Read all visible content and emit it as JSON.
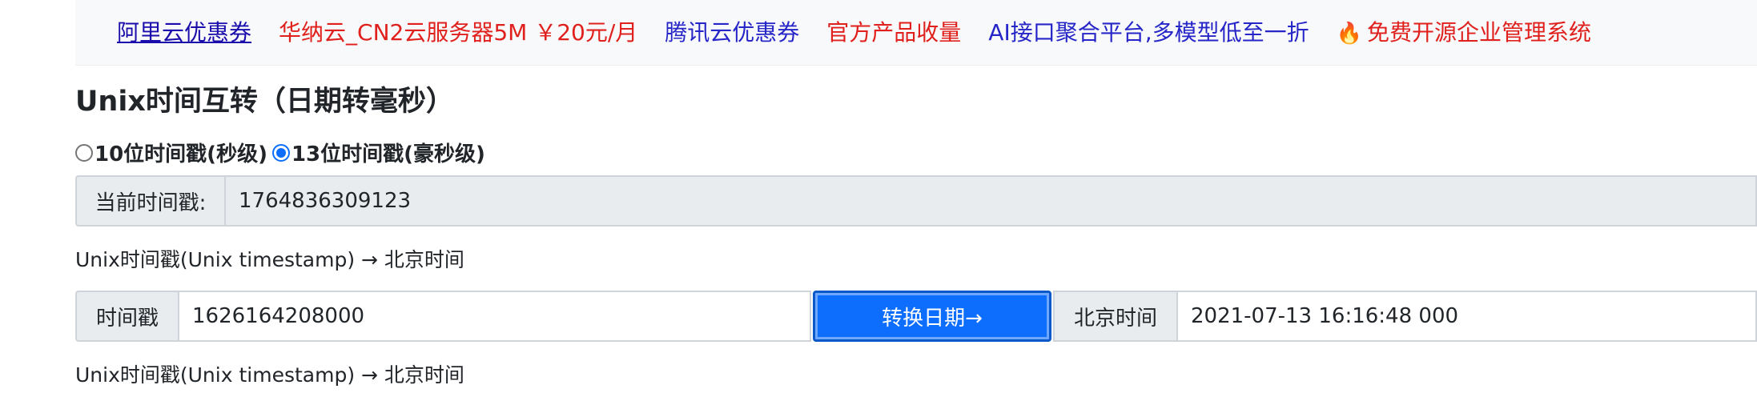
{
  "promo": {
    "links": [
      {
        "text": "阿里云优惠券",
        "color": "#1a0dab",
        "underline": true
      },
      {
        "text": "华纳云_CN2云服务器5M ￥20元/月",
        "color": "#e0201c",
        "underline": false
      },
      {
        "text": "腾讯云优惠券",
        "color": "#2626c8",
        "underline": false
      },
      {
        "text": "官方产品收量",
        "color": "#e0201c",
        "underline": false
      },
      {
        "text": "AI接口聚合平台,多模型低至一折",
        "color": "#2626c8",
        "underline": false
      },
      {
        "text": "免费开源企业管理系统",
        "color": "#e0201c",
        "underline": false,
        "icon": "🔥"
      }
    ]
  },
  "page": {
    "title": "Unix时间互转（日期转毫秒）"
  },
  "precision": {
    "option_10": "10位时间戳(秒级)",
    "option_13": "13位时间戳(豪秒级)",
    "selected": "13"
  },
  "current": {
    "label": "当前时间戳:",
    "value": "1764836309123"
  },
  "section1": {
    "note": "Unix时间戳(Unix timestamp) → 北京时间"
  },
  "converter": {
    "timestamp_label": "时间戳",
    "timestamp_value": "1626164208000",
    "button_label": "转换日期→",
    "result_label": "北京时间",
    "result_value": "2021-07-13 16:16:48 000"
  },
  "section2": {
    "note": "Unix时间戳(Unix timestamp) → 北京时间"
  }
}
